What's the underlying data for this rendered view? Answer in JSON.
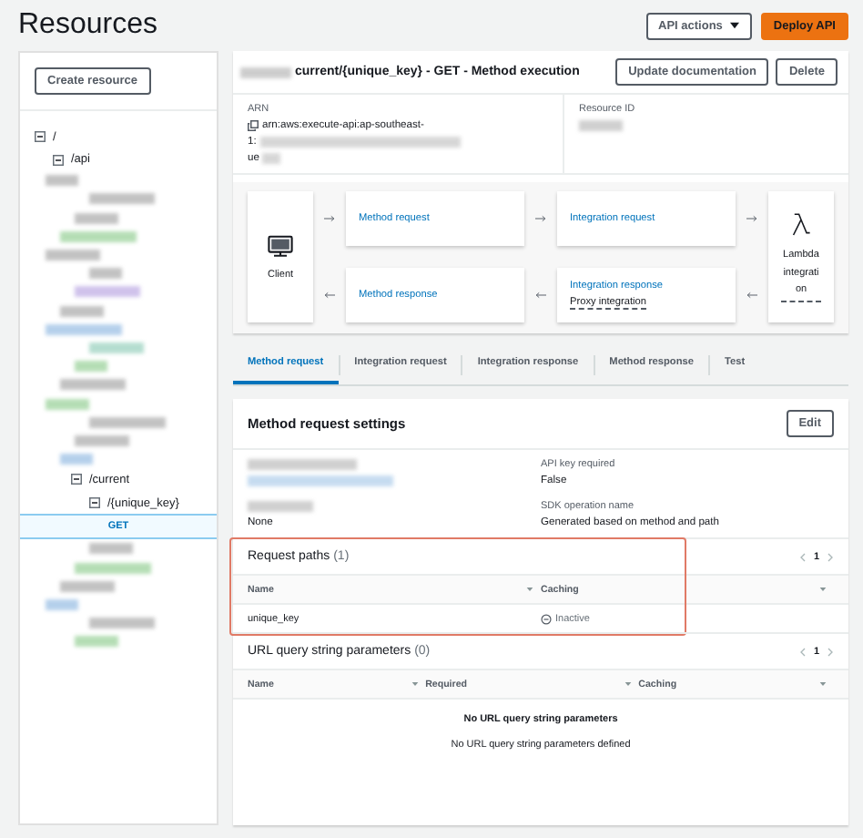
{
  "page_title": "Resources",
  "header_buttons": [
    {
      "label": "API actions",
      "kind": "dropdown"
    },
    {
      "label": "Deploy API",
      "kind": "primary"
    }
  ],
  "sidebar": {
    "create_button": "Create resource",
    "tree": [
      {
        "kind": "resource",
        "label": "/",
        "expanded": true,
        "children": [
          {
            "kind": "resource",
            "label": "/api",
            "expanded": true,
            "children": [
              {
                "kind": "redacted",
                "color": "#b8b8b8"
              },
              {
                "kind": "redacted",
                "color": "#b8b8b8"
              },
              {
                "kind": "redacted",
                "color": "#b8b8b8"
              },
              {
                "kind": "redacted",
                "color": "#a8d8a8"
              },
              {
                "kind": "redacted",
                "color": "#b8b8b8"
              },
              {
                "kind": "redacted",
                "color": "#b8b8b8"
              },
              {
                "kind": "redacted",
                "color": "#c8b8e8"
              },
              {
                "kind": "redacted",
                "color": "#b8b8b8"
              },
              {
                "kind": "redacted",
                "color": "#a8c8e8"
              },
              {
                "kind": "redacted",
                "color": "#a8d8c8"
              },
              {
                "kind": "redacted",
                "color": "#a8d8a8"
              },
              {
                "kind": "redacted",
                "color": "#b8b8b8"
              },
              {
                "kind": "redacted",
                "color": "#a8d8a8"
              },
              {
                "kind": "redacted",
                "color": "#b8b8b8"
              },
              {
                "kind": "redacted",
                "color": "#b8b8b8"
              },
              {
                "kind": "redacted",
                "color": "#a8c8e8"
              },
              {
                "kind": "resource",
                "label": "/current",
                "expanded": true,
                "children": [
                  {
                    "kind": "resource",
                    "label": "/{unique_key}",
                    "expanded": true,
                    "children": [
                      {
                        "kind": "method",
                        "label": "GET",
                        "selected": true
                      }
                    ]
                  }
                ]
              },
              {
                "kind": "redacted",
                "color": "#b8b8b8"
              },
              {
                "kind": "redacted",
                "color": "#a8d8a8"
              },
              {
                "kind": "redacted",
                "color": "#b8b8b8"
              },
              {
                "kind": "redacted",
                "color": "#a8c8e8"
              },
              {
                "kind": "redacted",
                "color": "#b8b8b8"
              },
              {
                "kind": "redacted",
                "color": "#a8d8a8"
              }
            ]
          }
        ]
      }
    ]
  },
  "method": {
    "title": "current/{unique_key} - GET - Method execution",
    "buttons": [
      "Update documentation",
      "Delete"
    ],
    "arn_label": "ARN",
    "arn_lines": [
      "arn:aws:execute-api:ap-southeast-",
      "1:",
      "ue"
    ],
    "resource_id_label": "Resource ID"
  },
  "flow": {
    "client": "Client",
    "method_request": "Method request",
    "integration_request": "Integration request",
    "method_response": "Method response",
    "integration_response": "Integration response",
    "integration_response_sub": "Proxy integration",
    "lambda": "Lambda integration"
  },
  "tabs": [
    {
      "label": "Method request",
      "selected": true
    },
    {
      "label": "Integration request",
      "selected": false
    },
    {
      "label": "Integration response",
      "selected": false
    },
    {
      "label": "Method response",
      "selected": false
    },
    {
      "label": "Test",
      "selected": false
    }
  ],
  "settings": {
    "title": "Method request settings",
    "edit_button": "Edit",
    "left_fields": [
      {
        "kind": "redacted"
      },
      {
        "kind": "redacted_label",
        "value": "None"
      }
    ],
    "right_fields": [
      {
        "label": "API key required",
        "value": "False"
      },
      {
        "label": "SDK operation name",
        "value": "Generated based on method and path"
      }
    ]
  },
  "request_paths": {
    "title": "Request paths",
    "count": "(1)",
    "page": "1",
    "highlighted": true,
    "columns": [
      "Name",
      "Caching"
    ],
    "rows": [
      {
        "name": "unique_key",
        "caching": "Inactive"
      }
    ]
  },
  "query_params": {
    "title": "URL query string parameters",
    "count": "(0)",
    "page": "1",
    "columns": [
      "Name",
      "Required",
      "Caching"
    ],
    "empty_title": "No URL query string parameters",
    "empty_text": "No URL query string parameters defined"
  }
}
